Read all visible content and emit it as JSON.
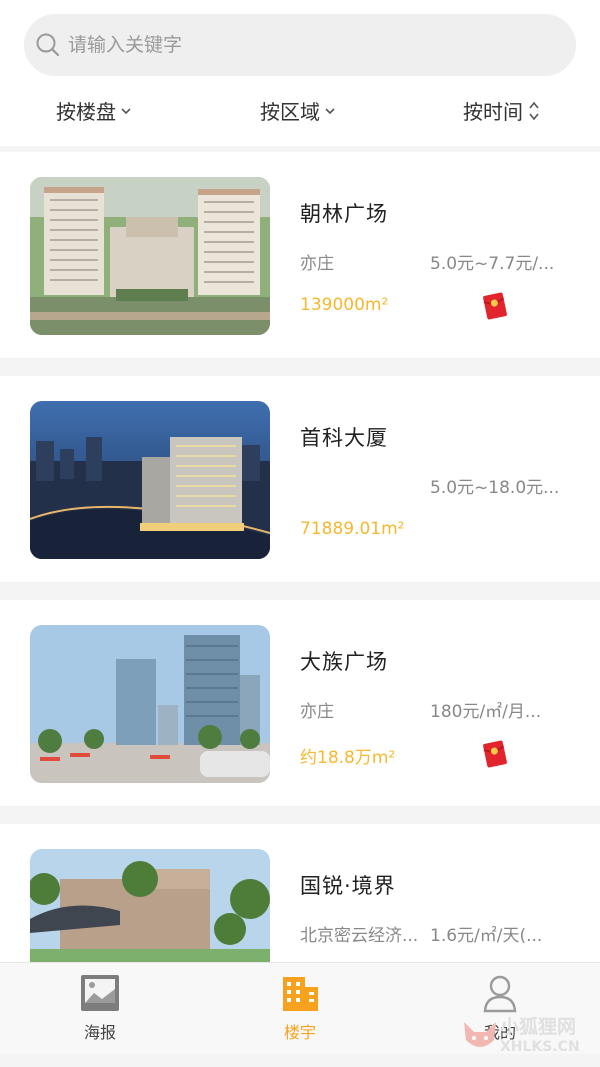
{
  "search": {
    "placeholder": "请输入关键字"
  },
  "filters": [
    {
      "label": "按楼盘"
    },
    {
      "label": "按区域"
    },
    {
      "label": "按时间"
    }
  ],
  "listings": [
    {
      "title": "朝林广场",
      "area": "亦庄",
      "price": "5.0元~7.7元/...",
      "size": "139000m²",
      "has_hongbao": true
    },
    {
      "title": "首科大厦",
      "area": "",
      "price": "5.0元~18.0元...",
      "size": "71889.01m²",
      "has_hongbao": false
    },
    {
      "title": "大族广场",
      "area": "亦庄",
      "price": "180元/㎡/月...",
      "size": "约18.8万m²",
      "has_hongbao": true
    },
    {
      "title": "国锐·境界",
      "area": "北京密云经济...",
      "price": "1.6元/㎡/天(...",
      "size": "",
      "has_hongbao": false
    }
  ],
  "tabbar": {
    "items": [
      {
        "label": "海报",
        "icon": "image-icon"
      },
      {
        "label": "楼宇",
        "icon": "building-icon",
        "active": true
      },
      {
        "label": "我的",
        "icon": "user-icon"
      }
    ]
  },
  "colors": {
    "accent": "#f6a21e",
    "size_text": "#f5b82e",
    "hongbao": "#e2242c"
  },
  "watermark": {
    "line1": "小狐狸网",
    "line2": "XHLKS.CN"
  }
}
